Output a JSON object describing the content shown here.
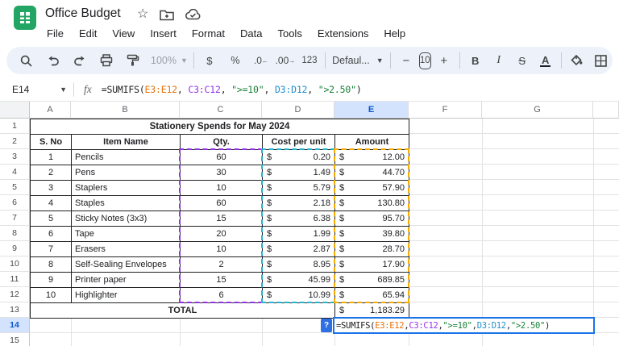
{
  "app": {
    "title": "Office Budget"
  },
  "menu": {
    "items": [
      "File",
      "Edit",
      "View",
      "Insert",
      "Format",
      "Data",
      "Tools",
      "Extensions",
      "Help"
    ]
  },
  "toolbar": {
    "zoom": "100%",
    "currency": "$",
    "percent": "%",
    "decrease_decimals": ".0",
    "increase_decimals": ".00",
    "more_formats": "123",
    "font": "Defaul...",
    "font_size": "10",
    "minus": "−",
    "plus": "+",
    "bold": "B",
    "italic": "I",
    "strikethrough": "S",
    "text_color": "A",
    "caret": "▾"
  },
  "formula_bar": {
    "cell_ref": "E14",
    "fx_label": "fx"
  },
  "formula_parts": [
    {
      "text": "=SUMIFS(",
      "color": "#202124"
    },
    {
      "text": "E3:E12",
      "color": "#e8710a"
    },
    {
      "text": ", ",
      "color": "#202124"
    },
    {
      "text": "C3:C12",
      "color": "#9334e6"
    },
    {
      "text": ", ",
      "color": "#202124"
    },
    {
      "text": "\">=10\"",
      "color": "#188038"
    },
    {
      "text": ", ",
      "color": "#202124"
    },
    {
      "text": "D3:D12",
      "color": "#1d8ece"
    },
    {
      "text": ", ",
      "color": "#202124"
    },
    {
      "text": "\">2.50\"",
      "color": "#188038"
    },
    {
      "text": ")",
      "color": "#202124"
    }
  ],
  "sheet": {
    "col_letters": [
      "A",
      "B",
      "C",
      "D",
      "E",
      "F",
      "G",
      ""
    ],
    "selected_col": "E",
    "row_numbers": [
      "1",
      "2",
      "3",
      "4",
      "5",
      "6",
      "7",
      "8",
      "9",
      "10",
      "11",
      "12",
      "13",
      "14",
      "15"
    ],
    "selected_row": "14",
    "table_title": "Stationery Spends for May 2024",
    "headers": [
      "S. No",
      "Item Name",
      "Qty.",
      "Cost per unit",
      "Amount"
    ],
    "currency_symbol": "$",
    "rows": [
      {
        "sno": "1",
        "item": "Pencils",
        "qty": "60",
        "cost": "0.20",
        "amount": "12.00"
      },
      {
        "sno": "2",
        "item": "Pens",
        "qty": "30",
        "cost": "1.49",
        "amount": "44.70"
      },
      {
        "sno": "3",
        "item": "Staplers",
        "qty": "10",
        "cost": "5.79",
        "amount": "57.90"
      },
      {
        "sno": "4",
        "item": "Staples",
        "qty": "60",
        "cost": "2.18",
        "amount": "130.80"
      },
      {
        "sno": "5",
        "item": "Sticky Notes (3x3)",
        "qty": "15",
        "cost": "6.38",
        "amount": "95.70"
      },
      {
        "sno": "6",
        "item": "Tape",
        "qty": "20",
        "cost": "1.99",
        "amount": "39.80"
      },
      {
        "sno": "7",
        "item": "Erasers",
        "qty": "10",
        "cost": "2.87",
        "amount": "28.70"
      },
      {
        "sno": "8",
        "item": "Self-Sealing Envelopes",
        "qty": "2",
        "cost": "8.95",
        "amount": "17.90"
      },
      {
        "sno": "9",
        "item": "Printer paper",
        "qty": "15",
        "cost": "45.99",
        "amount": "689.85"
      },
      {
        "sno": "10",
        "item": "Highlighter",
        "qty": "6",
        "cost": "10.99",
        "amount": "65.94"
      }
    ],
    "total_label": "TOTAL",
    "total_amount": "1,183.29",
    "help_badge": "?"
  },
  "colors": {
    "accent": "#1a73e8",
    "selection_bg": "#d3e3fd",
    "range_c_dash": "#9334e6",
    "range_d_dash": "#26b5ce",
    "range_e_dash": "#f9ab00",
    "string_green": "#188038",
    "range_orange_text": "#e8710a",
    "logo_green": "#23a566"
  }
}
